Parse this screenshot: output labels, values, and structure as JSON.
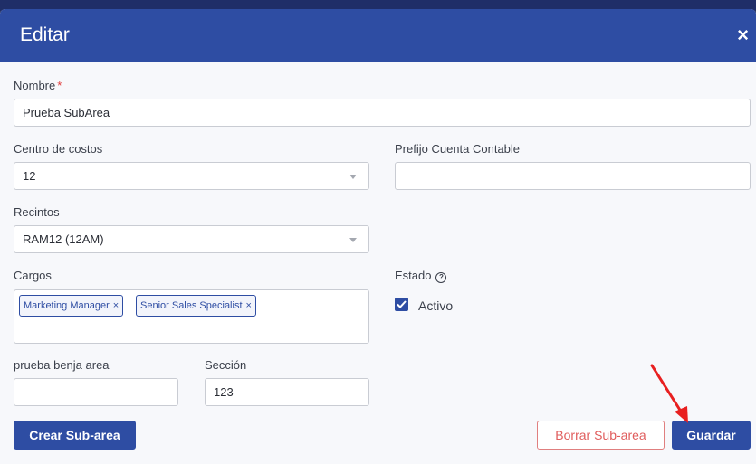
{
  "modal": {
    "title": "Editar",
    "close_glyph": "×"
  },
  "form": {
    "nombre": {
      "label": "Nombre",
      "required_mark": "*",
      "value": "Prueba SubArea"
    },
    "centro_costos": {
      "label": "Centro de costos",
      "value": "12"
    },
    "prefijo": {
      "label": "Prefijo Cuenta Contable",
      "value": ""
    },
    "recintos": {
      "label": "Recintos",
      "value": "RAM12 (12AM)"
    },
    "cargos": {
      "label": "Cargos",
      "tags": [
        {
          "label": "Marketing Manager",
          "remove": "×"
        },
        {
          "label": "Senior Sales Specialist",
          "remove": "×"
        }
      ]
    },
    "estado": {
      "label": "Estado",
      "help_glyph": "?",
      "checkbox_label": "Activo",
      "checked": true
    },
    "prueba": {
      "label": "prueba benja area",
      "value": ""
    },
    "seccion": {
      "label": "Sección",
      "value": "123"
    }
  },
  "buttons": {
    "crear": "Crear Sub-area",
    "borrar": "Borrar Sub-area",
    "guardar": "Guardar"
  },
  "colors": {
    "primary": "#2e4da3",
    "danger": "#e05d5d",
    "annotation_arrow": "#e82020"
  }
}
